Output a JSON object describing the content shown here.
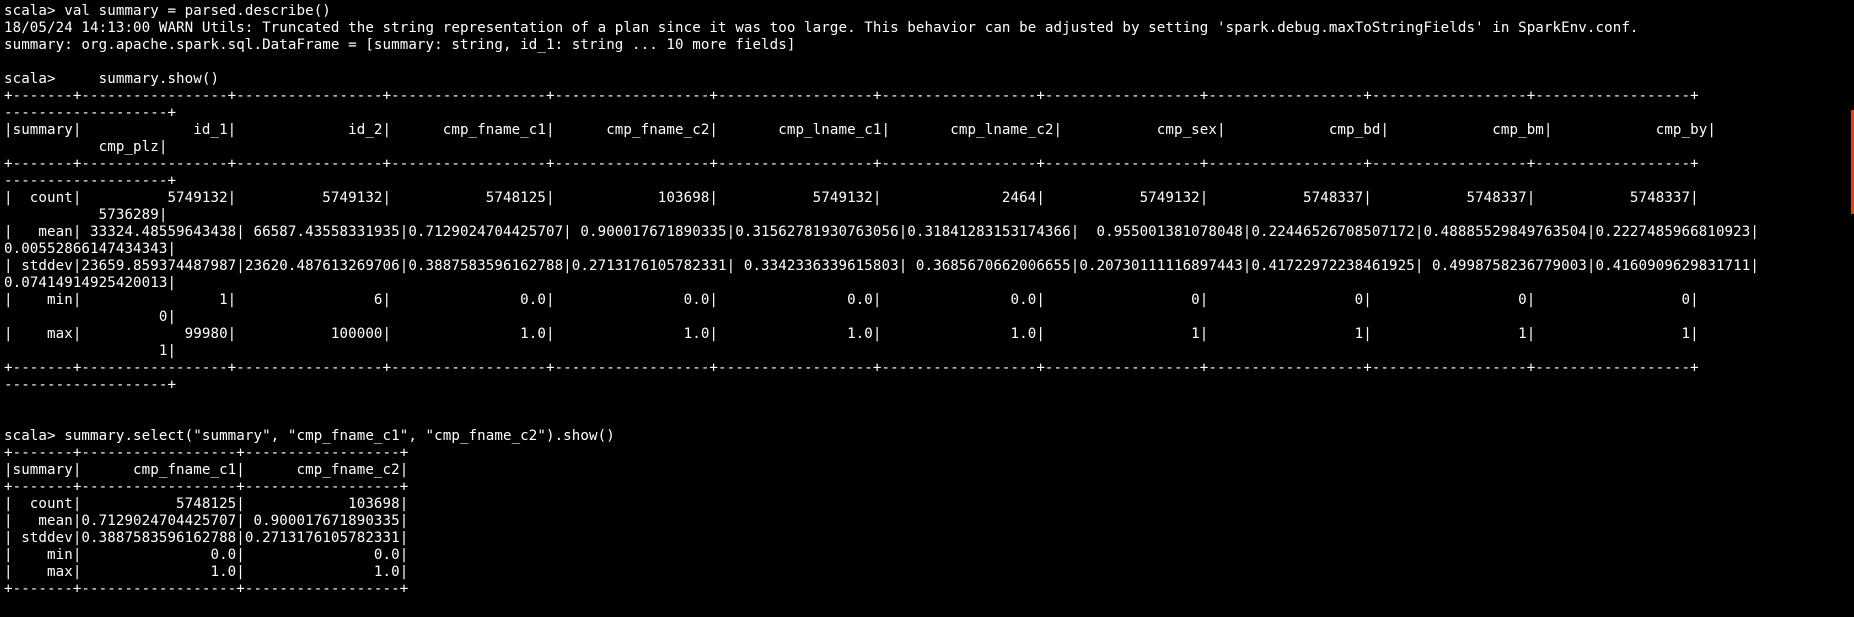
{
  "terminal": {
    "lines": [
      "scala> val summary = parsed.describe()",
      "18/05/24 14:13:00 WARN Utils: Truncated the string representation of a plan since it was too large. This behavior can be adjusted by setting 'spark.debug.maxToStringFields' in SparkEnv.conf.",
      "summary: org.apache.spark.sql.DataFrame = [summary: string, id_1: string ... 10 more fields]",
      "",
      "scala>     summary.show()",
      "+-------+-----------------+-----------------+------------------+------------------+------------------+------------------+------------------+------------------+------------------+------------------+",
      "-------------------+",
      "|summary|             id_1|             id_2|      cmp_fname_c1|      cmp_fname_c2|       cmp_lname_c1|       cmp_lname_c2|           cmp_sex|            cmp_bd|            cmp_bm|            cmp_by|",
      "           cmp_plz|",
      "+-------+-----------------+-----------------+------------------+------------------+------------------+------------------+------------------+------------------+------------------+------------------+",
      "-------------------+",
      "|  count|          5749132|          5749132|           5748125|            103698|           5749132|              2464|           5749132|           5748337|           5748337|           5748337|",
      "           5736289|",
      "|   mean| 33324.48559643438| 66587.43558331935|0.7129024704425707| 0.900017671890335|0.31562781930763056|0.31841283153174366|  0.955001381078048|0.22446526708507172|0.48885529849763504|0.2227485966810923|",
      "0.00552866147434343|",
      "| stddev|23659.859374487987|23620.487613269706|0.3887583596162788|0.2713176105782331| 0.3342336339615803| 0.3685670662006655|0.20730111116897443|0.41722972238461925| 0.4998758236779003|0.4160909629831711|",
      "0.07414914925420013|",
      "|    min|                1|                6|               0.0|               0.0|               0.0|               0.0|                 0|                 0|                 0|                 0|",
      "                  0|",
      "|    max|            99980|           100000|               1.0|               1.0|               1.0|               1.0|                 1|                 1|                 1|                 1|",
      "                  1|",
      "+-------+-----------------+-----------------+------------------+------------------+------------------+------------------+------------------+------------------+------------------+------------------+",
      "-------------------+",
      "",
      "",
      "scala> summary.select(\"summary\", \"cmp_fname_c1\", \"cmp_fname_c2\").show()",
      "+-------+------------------+------------------+",
      "|summary|      cmp_fname_c1|      cmp_fname_c2|",
      "+-------+------------------+------------------+",
      "|  count|           5748125|            103698|",
      "|   mean|0.7129024704425707| 0.900017671890335|",
      "| stddev|0.3887583596162788|0.2713176105782331|",
      "|    min|               0.0|               0.0|",
      "|    max|               1.0|               1.0|",
      "+-------+------------------+------------------+"
    ]
  },
  "colors": {
    "background": "#000000",
    "foreground": "#ffffff",
    "scroll_marker": "#d44a20"
  }
}
